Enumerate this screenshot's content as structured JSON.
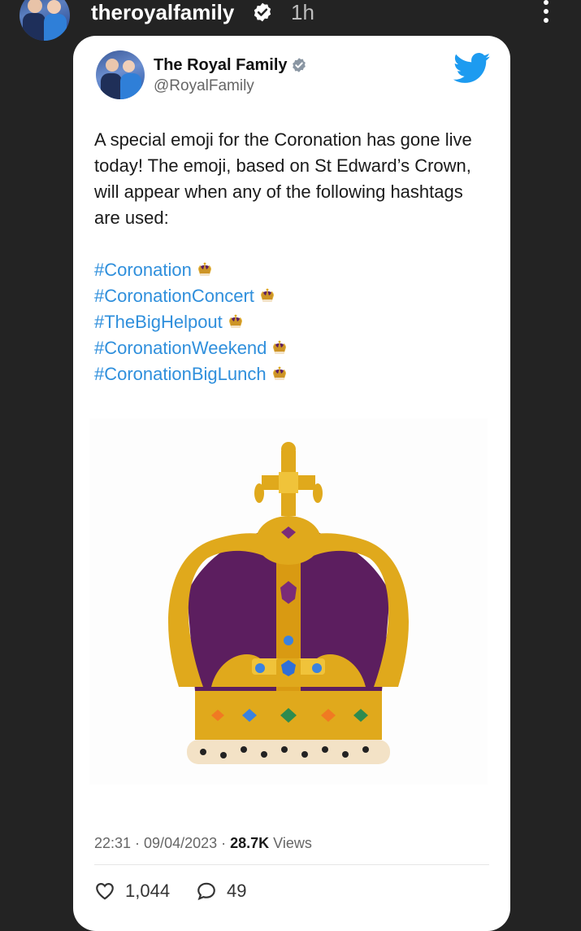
{
  "story": {
    "username": "theroyalfamily",
    "time": "1h",
    "avatar_icon": "avatar",
    "verified_icon": "verified-badge-icon",
    "more_icon": "more-vertical-icon"
  },
  "tweet": {
    "display_name": "The Royal Family",
    "handle": "@RoyalFamily",
    "text": "A special emoji for the Coronation has gone live today! The emoji, based on St Edward’s Crown, will appear when any of the following hashtags are used:",
    "hashtags": [
      "#Coronation",
      "#CoronationConcert",
      "#TheBigHelpout",
      "#CoronationWeekend",
      "#CoronationBigLunch"
    ],
    "image_icon": "crown-emoji-image",
    "timestamp": "22:31 · 09/04/2023 · ",
    "views_count": "28.7K",
    "views_label": " Views",
    "likes": "1,044",
    "replies": "49",
    "colors": {
      "hashtag": "#2f8fdc",
      "twitter_blue": "#1d9bf0",
      "crown_gold": "#e0a91c",
      "crown_purple": "#5c1e5f"
    }
  }
}
